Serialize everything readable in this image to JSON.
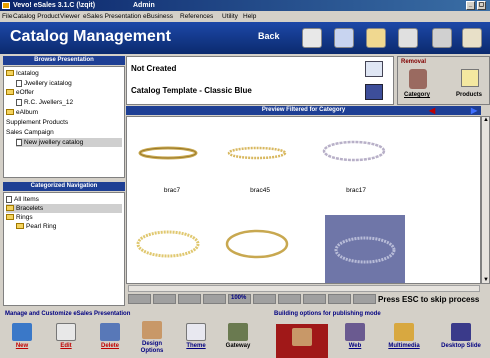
{
  "window": {
    "title": "Vevo! eSales 3.1.C (\\zqit)",
    "user": "Admin",
    "controls": [
      "_",
      "▢",
      "✕"
    ]
  },
  "menu": [
    "File",
    "Catalog Product",
    "Viewer",
    "eSales Presentation",
    "eBusiness",
    "References",
    "Utility",
    "Help"
  ],
  "header": {
    "title": "Catalog Management",
    "back_label": "Back"
  },
  "browse": {
    "title": "Browse Presentation",
    "items": [
      "Icatalog",
      "Jwellery icatalog",
      "eOffer",
      "R.C. Jwellers_12",
      "eAlbum",
      "Supplement Products",
      "Sales Campaign",
      "New jwellery catalog"
    ]
  },
  "categorized": {
    "title": "Categorized Navigation",
    "items": [
      "All Items",
      "Bracelets",
      "Rings",
      "Pearl Ring"
    ]
  },
  "info": {
    "status": "Not Created",
    "template": "Catalog Template - Classic Blue"
  },
  "removal": {
    "title": "Removal",
    "category_label": "Category",
    "products_label": "Products"
  },
  "preview": {
    "title": "Preview Filtered for Category",
    "captions": [
      "brac7",
      "brac45",
      "brac17"
    ]
  },
  "progress": {
    "percent_text": "100%",
    "value": 1.0,
    "message": "Press ESC to skip process"
  },
  "customize": {
    "title": "Manage and Customize eSales Presentation",
    "buttons": [
      "New",
      "Edit",
      "Delete",
      "Design\nOptions",
      "Theme",
      "Gateway"
    ]
  },
  "publish": {
    "title": "Building options for publishing mode",
    "buttons": [
      "",
      "Web",
      "Multimedia",
      "Desktop Slide"
    ]
  },
  "colors": {
    "header_bg": "#0d2f7a",
    "panel_head": "#1e3f94",
    "delete_red": "#c00000"
  }
}
